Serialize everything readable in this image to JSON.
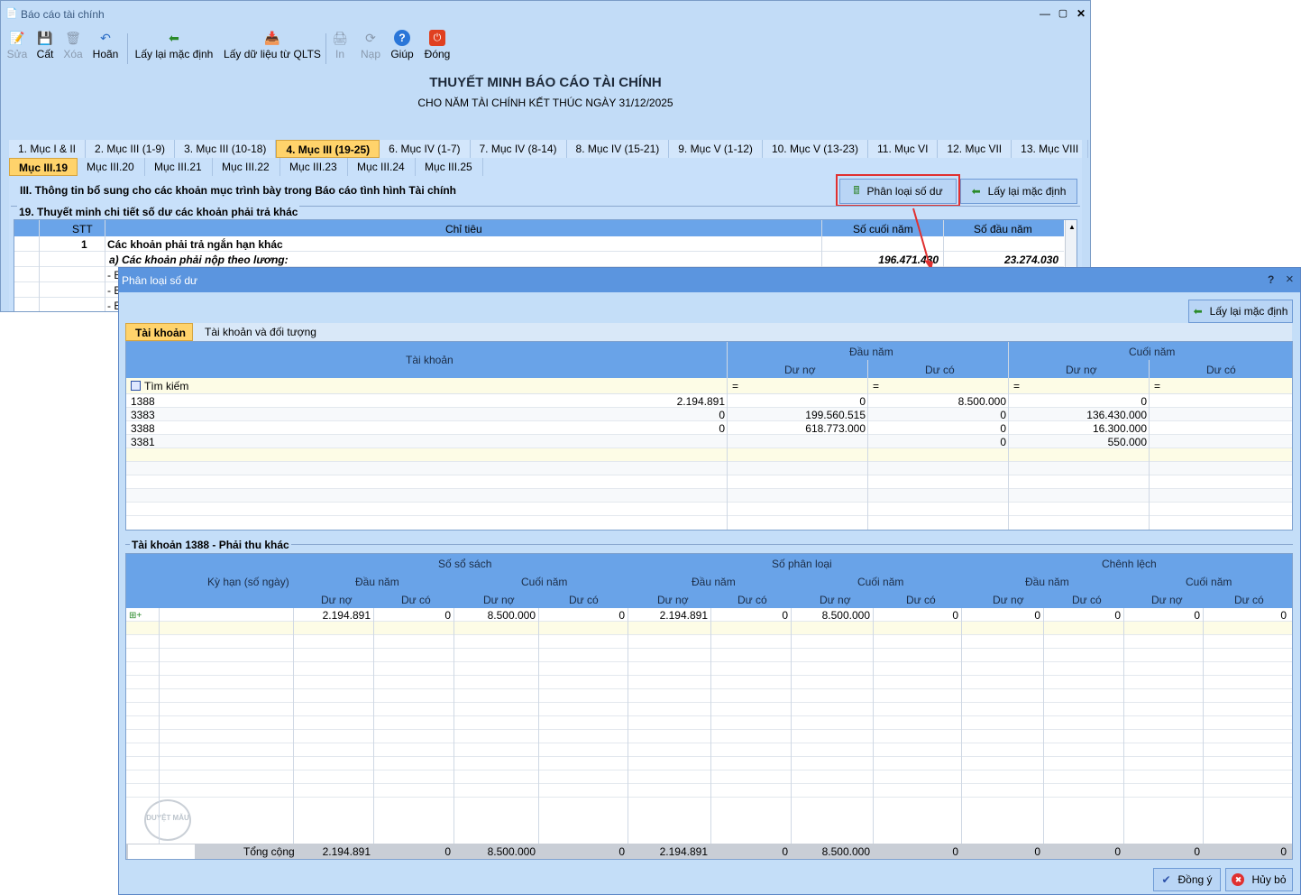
{
  "main_window": {
    "title": "Báo cáo tài chính"
  },
  "toolbar": {
    "edit": "Sửa",
    "save": "Cất",
    "delete": "Xóa",
    "undo": "Hoãn",
    "reset_default": "Lấy lại mặc định",
    "get_qlts": "Lấy dữ liệu từ QLTS",
    "print": "In",
    "reload": "Nạp",
    "help": "Giúp",
    "close": "Đóng"
  },
  "report": {
    "title": "THUYẾT MINH BÁO CÁO TÀI CHÍNH",
    "subtitle": "CHO NĂM TÀI CHÍNH KẾT THÚC NGÀY 31/12/2025"
  },
  "tabs": [
    "1. Mục I & II",
    "2. Mục III (1-9)",
    "3. Mục III (10-18)",
    "4. Mục III (19-25)",
    "6. Mục IV (1-7)",
    "7. Mục IV (8-14)",
    "8. Mục IV (15-21)",
    "9. Mục V (1-12)",
    "10. Mục V (13-23)",
    "11. Mục VI",
    "12. Mục VII",
    "13. Mục VIII"
  ],
  "subtabs": [
    "Mục III.19",
    "Mục III.20",
    "Mục III.21",
    "Mục III.22",
    "Mục III.23",
    "Mục III.24",
    "Mục III.25"
  ],
  "section": {
    "heading": "III. Thông tin bổ sung cho các khoản mục trình bày trong Báo cáo tình hình Tài chính",
    "classify_btn": "Phân loại số dư",
    "reset_btn": "Lấy lại mặc định",
    "group_title": "19. Thuyết minh chi tiết số dư các khoản phải trả khác"
  },
  "main_table": {
    "headers": {
      "stt": "STT",
      "chitieu": "Chỉ tiêu",
      "socuoinam": "Số cuối năm",
      "sodaunam": "Số đầu năm"
    },
    "rows": [
      {
        "stt": "1",
        "label": "Các khoản phải trả ngắn hạn khác",
        "end": "",
        "start": ""
      },
      {
        "stt": "",
        "label": "a) Các khoản phải nộp theo lương:",
        "end": "196.471.430",
        "start": "23.274.030"
      },
      {
        "stt": "",
        "label": "- B",
        "end": "",
        "start": ""
      },
      {
        "stt": "",
        "label": "- B",
        "end": "",
        "start": ""
      },
      {
        "stt": "",
        "label": "- B",
        "end": "",
        "start": ""
      }
    ]
  },
  "dialog": {
    "title": "Phân loại số dư",
    "help": "?",
    "close": "×",
    "reset_btn": "Lấy lại mặc định",
    "tabs": [
      "Tài khoản",
      "Tài khoản và đối tượng"
    ],
    "top_grid": {
      "col_account": "Tài khoản",
      "grp_start": "Đầu năm",
      "grp_end": "Cuối năm",
      "debit": "Dư nợ",
      "credit": "Dư có",
      "search": "Tìm kiếm",
      "eq": "=",
      "rows": [
        [
          "1388",
          "2.194.891",
          "0",
          "8.500.000",
          "0"
        ],
        [
          "3383",
          "0",
          "199.560.515",
          "0",
          "136.430.000"
        ],
        [
          "3388",
          "0",
          "618.773.000",
          "0",
          "16.300.000"
        ],
        [
          "3381",
          "",
          "",
          "0",
          "550.000"
        ]
      ]
    },
    "detail_title": "Tài khoản 1388 - Phải thu khác",
    "bottom_grid": {
      "term": "Kỳ hạn (số ngày)",
      "books": "Số sổ sách",
      "classified": "Số phân loại",
      "diff": "Chênh lệch",
      "start": "Đầu năm",
      "end": "Cuối năm",
      "debit": "Dư nợ",
      "credit": "Dư có",
      "row": [
        "2.194.891",
        "0",
        "8.500.000",
        "0",
        "2.194.891",
        "0",
        "8.500.000",
        "0",
        "0",
        "0",
        "0",
        "0"
      ],
      "total_label": "Tổng cộng",
      "total": [
        "2.194.891",
        "0",
        "8.500.000",
        "0",
        "2.194.891",
        "0",
        "8.500.000",
        "0",
        "0",
        "0",
        "0",
        "0"
      ]
    },
    "ok": "Đồng ý",
    "cancel": "Hủy bỏ"
  }
}
